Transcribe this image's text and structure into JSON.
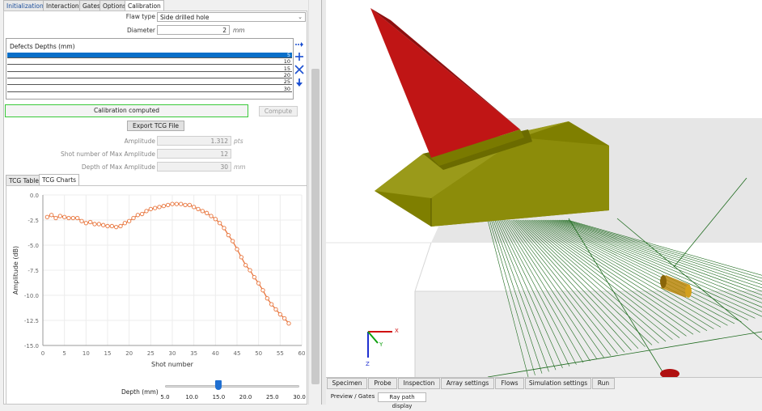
{
  "top_tabs": [
    "Initialization",
    "Interactions",
    "Gates",
    "Options",
    "Calibration"
  ],
  "flaw": {
    "label": "Flaw type",
    "value": "Side drilled hole"
  },
  "diameter": {
    "label": "Diameter",
    "value": "2",
    "unit": "mm"
  },
  "defects": {
    "header": "Defects Depths (mm)",
    "rows": [
      "5",
      "10",
      "15",
      "20",
      "25",
      "30"
    ],
    "selected_index": 0
  },
  "status": {
    "text": "Calibration computed",
    "compute_label": "Compute"
  },
  "export_label": "Export TCG File",
  "amplitude": {
    "label": "Amplitude",
    "value": "1.312",
    "unit": "pts"
  },
  "shot_max": {
    "label": "Shot number of Max Amplitude",
    "value": "12"
  },
  "depth_max": {
    "label": "Depth of Max Amplitude",
    "value": "30",
    "unit": "mm"
  },
  "sub_tabs": [
    "TCG Table",
    "TCG Charts"
  ],
  "chart_data": {
    "type": "line",
    "xlabel": "Shot number",
    "ylabel": "Amplitude (dB)",
    "xlim": [
      0,
      60
    ],
    "ylim": [
      -15,
      0
    ],
    "xticks": [
      "0",
      "5",
      "10",
      "15",
      "20",
      "25",
      "30",
      "35",
      "40",
      "45",
      "50",
      "55",
      "60"
    ],
    "yticks": [
      "0.0",
      "-2.5",
      "-5.0",
      "-7.5",
      "-10.0",
      "-12.5",
      "-15.0"
    ],
    "grid": true,
    "color": "#e8743b",
    "x": [
      1,
      2,
      3,
      4,
      5,
      6,
      7,
      8,
      9,
      10,
      11,
      12,
      13,
      14,
      15,
      16,
      17,
      18,
      19,
      20,
      21,
      22,
      23,
      24,
      25,
      26,
      27,
      28,
      29,
      30,
      31,
      32,
      33,
      34,
      35,
      36,
      37,
      38,
      39,
      40,
      41,
      42,
      43,
      44,
      45,
      46,
      47,
      48,
      49,
      50,
      51,
      52,
      53,
      54,
      55,
      56,
      57
    ],
    "y": [
      -2.2,
      -2.0,
      -2.3,
      -2.1,
      -2.2,
      -2.3,
      -2.3,
      -2.3,
      -2.6,
      -2.8,
      -2.7,
      -2.9,
      -2.9,
      -3.0,
      -3.1,
      -3.1,
      -3.2,
      -3.1,
      -2.8,
      -2.6,
      -2.3,
      -2.0,
      -1.9,
      -1.6,
      -1.4,
      -1.3,
      -1.2,
      -1.1,
      -1.0,
      -0.9,
      -0.9,
      -0.9,
      -1.0,
      -1.0,
      -1.2,
      -1.4,
      -1.6,
      -1.8,
      -2.1,
      -2.4,
      -2.8,
      -3.3,
      -4.0,
      -4.6,
      -5.4,
      -6.2,
      -7.0,
      -7.5,
      -8.2,
      -8.8,
      -9.5,
      -10.3,
      -10.9,
      -11.4,
      -11.9,
      -12.3,
      -12.8
    ]
  },
  "slider": {
    "label": "Depth (mm)",
    "ticks": [
      "5.0",
      "10.0",
      "15.0",
      "20.0",
      "25.0",
      "30.0"
    ],
    "value_fraction": 0.4
  },
  "bottom_tabs": [
    "Specimen",
    "Probe",
    "Inspection",
    "Array settings",
    "Flows",
    "Simulation settings",
    "Run"
  ],
  "sub_bottom_tabs": [
    "Preview / Gates",
    "Ray path display"
  ],
  "axes_labels": {
    "x": "X",
    "y": "Y",
    "z": "Z"
  }
}
